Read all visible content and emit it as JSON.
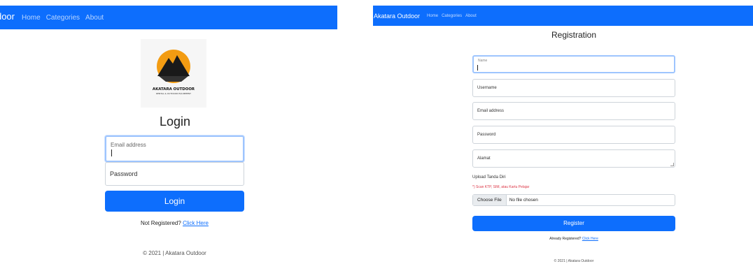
{
  "login_page": {
    "nav": {
      "brand": "Akatara Outdoor",
      "links": [
        "Home",
        "Categories",
        "About"
      ]
    },
    "logo": {
      "line1": "AKATARA OUTDOOR",
      "line2": "RENTAL & OUTDOOR EQUIPMENT"
    },
    "title": "Login",
    "email_label": "Email address",
    "password_label": "Password",
    "login_button": "Login",
    "register_prompt": "Not Registered?",
    "register_link": "Click Here",
    "footer": "© 2021 | Akatara Outdoor"
  },
  "registration_page": {
    "nav": {
      "brand": "Akatara Outdoor",
      "links": [
        "Home",
        "Categories",
        "About"
      ]
    },
    "title": "Registration",
    "fields": {
      "name": "Name",
      "username": "Username",
      "email": "Email address",
      "password": "Password",
      "address": "Alamat"
    },
    "upload_label": "Upload Tanda Diri",
    "upload_hint": "*) Scan KTP, SIM, atau Kartu Pelajar",
    "file_button": "Choose File",
    "file_status": "No file chosen",
    "register_button": "Register",
    "login_prompt": "Already Registered?",
    "login_link": "Click Here",
    "footer": "© 2021 | Akatara Outdoor"
  },
  "colors": {
    "primary": "#0d6efd",
    "focus_border": "#9ec5fe",
    "logo_orange": "#f39c12",
    "hint_red": "#dc3545"
  }
}
